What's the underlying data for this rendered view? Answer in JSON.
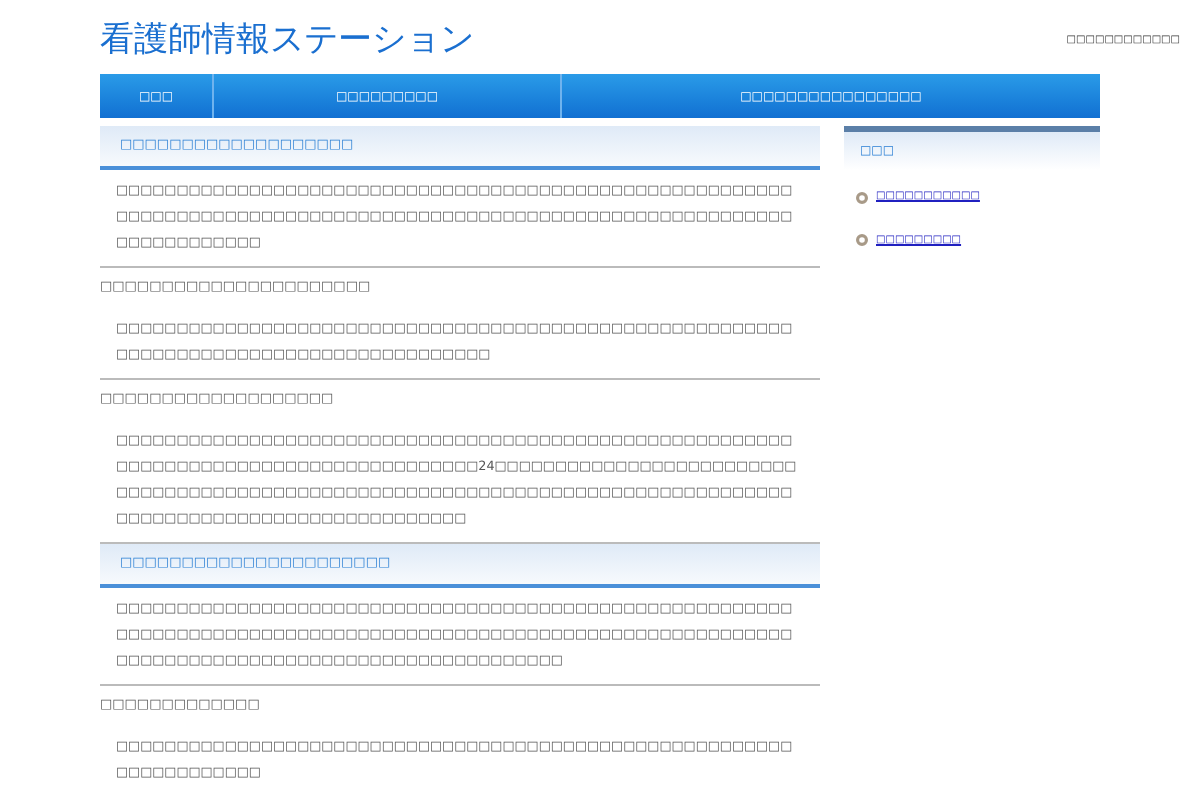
{
  "header": {
    "title": "看護師情報ステーション",
    "top_note": "□□□□□□□□□□□□"
  },
  "nav": [
    {
      "label": "□□□"
    },
    {
      "label": "□□□□□□□□□"
    },
    {
      "label": "□□□□□□□□□□□□□□□□"
    }
  ],
  "sections": [
    {
      "kind": "featured",
      "heading": "□□□□□□□□□□□□□□□□□□□",
      "paragraph": "□□□□□□□□□□□□□□□□□□□□□□□□□□□□□□□□□□□□□□□□□□□□□□□□□□□□□□□□□□□□□□□□□□□□□□□□□□□□□□□□□□□□□□□□□□□□□□□□□□□□□□□□□□□□□□□□□□□□□□□□□□□□"
    },
    {
      "kind": "plain",
      "heading": "□□□□□□□□□□□□□□□□□□□□□□",
      "paragraph": "□□□□□□□□□□□□□□□□□□□□□□□□□□□□□□□□□□□□□□□□□□□□□□□□□□□□□□□□□□□□□□□□□□□□□□□□□□□□□□□□□□□□□□□"
    },
    {
      "kind": "plain",
      "heading": "□□□□□□□□□□□□□□□□□□□",
      "paragraph": "□□□□□□□□□□□□□□□□□□□□□□□□□□□□□□□□□□□□□□□□□□□□□□□□□□□□□□□□□□□□□□□□□□□□□□□□□□□□□□□□□□□□□□24□□□□□□□□□□□□□□□□□□□□□□□□□□□□□□□□□□□□□□□□□□□□□□□□□□□□□□□□□□□□□□□□□□□□□□□□□□□□□□□□□□□□□□□□□□□□□□□□□□□□□□□□□□□□□□"
    },
    {
      "kind": "featured",
      "heading": "□□□□□□□□□□□□□□□□□□□□□□",
      "paragraph": "□□□□□□□□□□□□□□□□□□□□□□□□□□□□□□□□□□□□□□□□□□□□□□□□□□□□□□□□□□□□□□□□□□□□□□□□□□□□□□□□□□□□□□□□□□□□□□□□□□□□□□□□□□□□□□□□□□□□□□□□□□□□□□□□□□□□□□□□□□□□□□□□□□□□□"
    },
    {
      "kind": "plain",
      "heading": "□□□□□□□□□□□□□",
      "paragraph": "□□□□□□□□□□□□□□□□□□□□□□□□□□□□□□□□□□□□□□□□□□□□□□□□□□□□□□□□□□□□□□□□□□□□"
    }
  ],
  "sidebar": {
    "title": "□□□",
    "links": [
      {
        "label": "□□□□□□□□□□□"
      },
      {
        "label": "□□□□□□□□□"
      }
    ]
  }
}
